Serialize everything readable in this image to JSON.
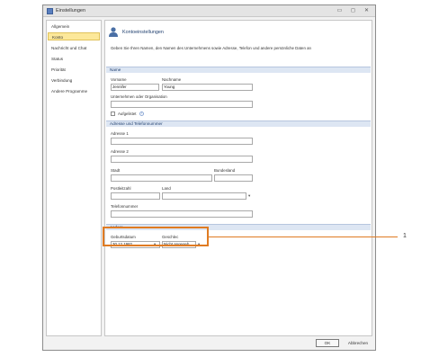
{
  "window": {
    "title": "Einstellungen",
    "controls": [
      "▭",
      "◻",
      "✕"
    ]
  },
  "sidebar": {
    "items": [
      {
        "label": "Allgemein"
      },
      {
        "label": "Konto"
      },
      {
        "label": "Nachricht und Chat"
      },
      {
        "label": "Status"
      },
      {
        "label": "Priorität"
      },
      {
        "label": "Verbindung"
      },
      {
        "label": "Andere Programme"
      }
    ],
    "active_index": 1
  },
  "header": {
    "title": "Kontoeinstellungen",
    "description": "Geben Sie Ihren Namen, den Namen des Unternehmens sowie Adresse, Telefon und andere persönliche Daten an"
  },
  "name_section": {
    "title": "Name",
    "first_name_label": "Vorname",
    "first_name_value": "Jennifer",
    "last_name_label": "Nachname",
    "last_name_value": "Young",
    "company_label": "Unternehmen oder Organisation",
    "company_value": "",
    "checkbox_label": "Aufgelistet",
    "info_glyph": "i"
  },
  "address_section": {
    "title": "Adresse und Telefonnummer",
    "address1_label": "Adresse 1",
    "address1_value": "",
    "address2_label": "Adresse 2",
    "address2_value": "",
    "city_label": "Stadt",
    "city_value": "",
    "state_label": "Bundesland",
    "state_value": "",
    "zip_label": "Postleitzahl",
    "zip_value": "",
    "country_label": "Land",
    "country_value": "",
    "phone_label": "Telefonnummer",
    "phone_value": ""
  },
  "other_section": {
    "title": "Andere",
    "birthday_label": "Geburtsdatum",
    "birthday_value": "30.12.1982",
    "gender_label": "Geschlec",
    "gender_value": "Nicht angegeb"
  },
  "callout": {
    "number": "1",
    "color": "#e07b22"
  },
  "buttons": {
    "ok": "OK",
    "cancel": "Abbrechen"
  },
  "colors": {
    "accent": "#1f3f6f",
    "selection": "#fce89a",
    "section_bg": "#dde6f3"
  }
}
